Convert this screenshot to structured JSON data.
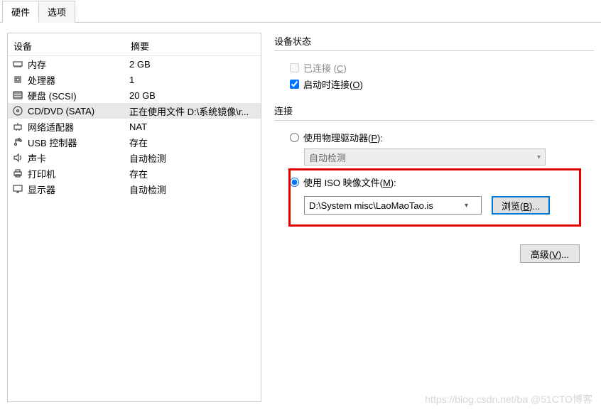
{
  "tabs": {
    "hardware": "硬件",
    "options": "选项"
  },
  "columns": {
    "device": "设备",
    "summary": "摘要"
  },
  "devices": [
    {
      "icon": "memory-icon",
      "label": "内存",
      "summary": "2 GB"
    },
    {
      "icon": "cpu-icon",
      "label": "处理器",
      "summary": "1"
    },
    {
      "icon": "disk-icon",
      "label": "硬盘 (SCSI)",
      "summary": "20 GB"
    },
    {
      "icon": "cd-icon",
      "label": "CD/DVD (SATA)",
      "summary": "正在使用文件 D:\\系统镜像\\r...",
      "selected": true
    },
    {
      "icon": "network-icon",
      "label": "网络适配器",
      "summary": "NAT"
    },
    {
      "icon": "usb-icon",
      "label": "USB 控制器",
      "summary": "存在"
    },
    {
      "icon": "sound-icon",
      "label": "声卡",
      "summary": "自动检测"
    },
    {
      "icon": "printer-icon",
      "label": "打印机",
      "summary": "存在"
    },
    {
      "icon": "display-icon",
      "label": "显示器",
      "summary": "自动检测"
    }
  ],
  "status": {
    "group_title": "设备状态",
    "connected": "已连接 (",
    "connected_u": "C",
    "connected_after": ")",
    "connect_at_power_on": "启动时连接(",
    "connect_at_power_on_u": "O",
    "connect_at_power_on_after": ")"
  },
  "connection": {
    "group_title": "连接",
    "physical": "使用物理驱动器(",
    "physical_u": "P",
    "physical_after": "):",
    "auto_detect": "自动检测",
    "use_iso": "使用 ISO 映像文件(",
    "use_iso_u": "M",
    "use_iso_after": "):",
    "iso_path": "D:\\System misc\\LaoMaoTao.is",
    "browse": "浏览(",
    "browse_u": "B",
    "browse_after": ")..."
  },
  "advanced": {
    "label": "高级(",
    "u": "V",
    "after": ")..."
  },
  "watermark": "https://blog.csdn.net/ba    @51CTO博客"
}
